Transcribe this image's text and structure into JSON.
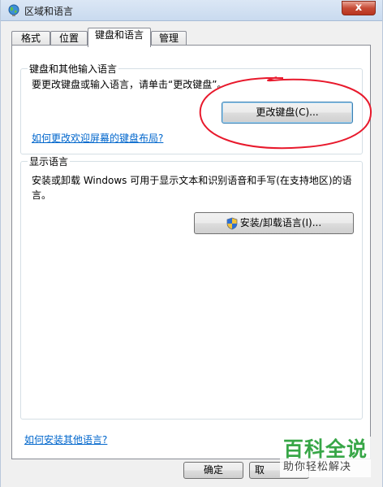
{
  "window": {
    "title": "区域和语言",
    "close_label": "x"
  },
  "tabs": [
    {
      "label": "格式"
    },
    {
      "label": "位置"
    },
    {
      "label": "键盘和语言"
    },
    {
      "label": "管理"
    }
  ],
  "keyboard_group": {
    "title": "键盘和其他输入语言",
    "description": "要更改键盘或输入语言，请单击“更改键盘”。",
    "change_button": "更改键盘(C)...",
    "welcome_link": "如何更改欢迎屏幕的键盘布局?"
  },
  "display_group": {
    "title": "显示语言",
    "description_line1": "安装或卸载 Windows 可用于显示文本和识别语音和手写(在支持地区)的语",
    "description_line2": "言。",
    "install_button": "安装/卸载语言(I)..."
  },
  "footer": {
    "install_link": "如何安装其他语言?",
    "ok_button": "确定",
    "cancel_button": "取"
  },
  "watermark": {
    "title": "百科全说",
    "subtitle": "助你轻松解决"
  },
  "colors": {
    "annotation": "#e8192c",
    "link": "#0066cc",
    "watermark_green": "#37a647"
  }
}
